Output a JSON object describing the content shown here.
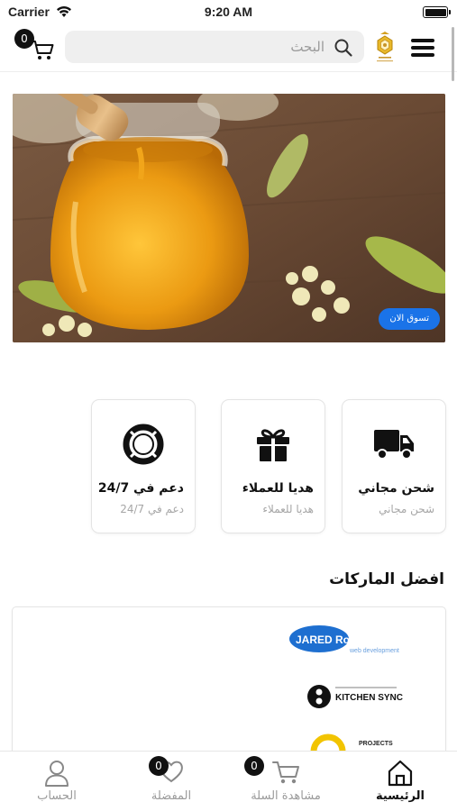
{
  "status_bar": {
    "carrier": "Carrier",
    "time": "9:20 AM"
  },
  "header": {
    "cart_count": "0",
    "search_placeholder": "البحث",
    "logo_icon": "honey-logo-icon",
    "menu_icon": "menu-icon"
  },
  "banner": {
    "button_label": "تسوق الان"
  },
  "features": [
    {
      "title": "شحن مجاني",
      "subtitle": "شحن مجاني",
      "icon": "truck-icon"
    },
    {
      "title": "هديا للعملاء",
      "subtitle": "هديا للعملاء",
      "icon": "gift-icon"
    },
    {
      "title": "دعم في 24/7",
      "subtitle": "دعم في 24/7",
      "icon": "lifebuoy-icon"
    }
  ],
  "brands": {
    "title": "افضل الماركات",
    "items": [
      {
        "name": "JARED Roussel",
        "tagline": "web development"
      },
      {
        "name": "KITCHEN SYNC"
      },
      {
        "name": "PROJECTS"
      }
    ]
  },
  "bottom_nav": {
    "items": [
      {
        "label": "الرئيسية",
        "icon": "home-icon",
        "active": true
      },
      {
        "label": "مشاهدة السلة",
        "icon": "cart-icon",
        "badge": "0"
      },
      {
        "label": "المفضلة",
        "icon": "heart-icon",
        "badge": "0"
      },
      {
        "label": "الحساب",
        "icon": "user-icon"
      }
    ]
  },
  "colors": {
    "accent": "#1a73e8",
    "badge": "#111111",
    "muted": "#9a9a9a"
  }
}
